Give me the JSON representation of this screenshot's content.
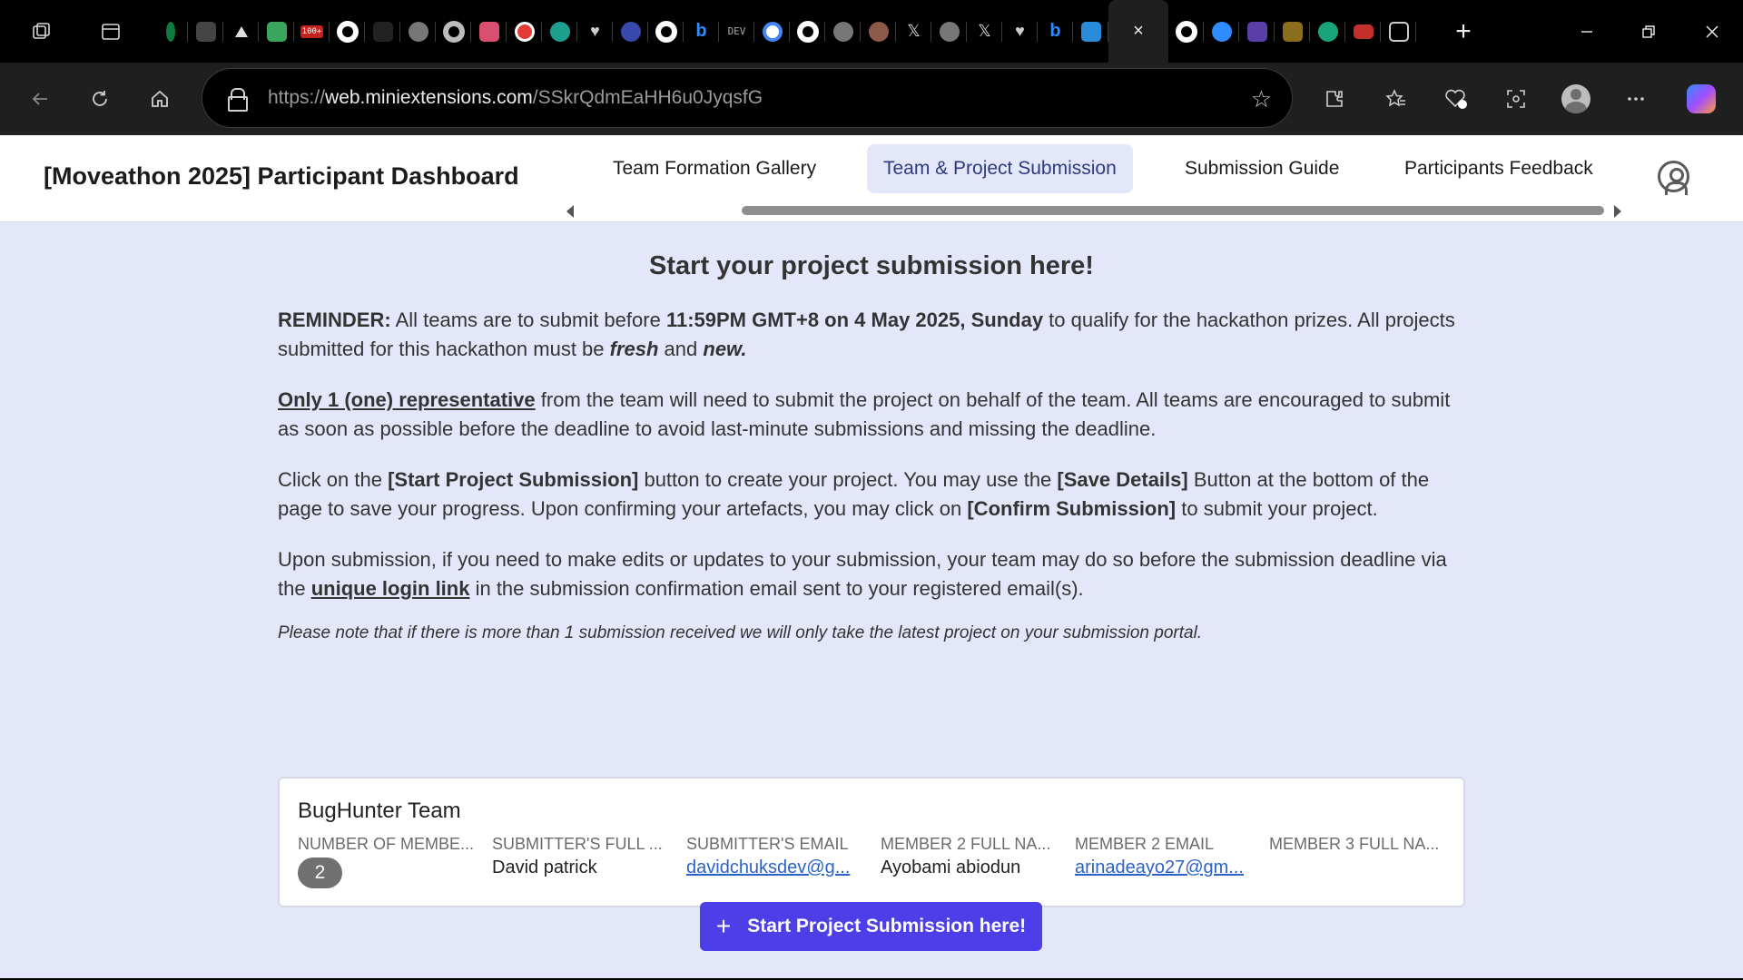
{
  "browser": {
    "url_prefix": "https://",
    "url_domain": "web.miniextensions.com",
    "url_path": "/SSkrQdmEaHH6u0JyqsfG",
    "active_tab_close": "×",
    "new_tab": "+",
    "fav_dev_label": "DEV",
    "fav_100_label": "100+",
    "fav_x_label": "𝕏",
    "colors": {
      "frame": "#000000",
      "toolbar": "#1f1f1f"
    }
  },
  "header": {
    "title": "[Moveathon 2025] Participant Dashboard",
    "tabs": [
      {
        "label": "Team Formation Gallery",
        "active": false
      },
      {
        "label": "Team & Project Submission",
        "active": true
      },
      {
        "label": "Submission Guide",
        "active": false
      },
      {
        "label": "Participants Feedback",
        "active": false
      }
    ]
  },
  "main": {
    "heading": "Start your project submission here!",
    "reminder": {
      "label": "REMINDER:",
      "text1": " All teams are to submit before ",
      "deadline": "11:59PM GMT+8 on 4 May 2025, Sunday",
      "text2": " to qualify for the hackathon prizes. All projects submitted for this hackathon must be ",
      "fresh": "fresh",
      "and": " and ",
      "new": "new."
    },
    "representative": {
      "emph": "Only 1 (one) representative",
      "text": " from the team will need to submit the project on behalf of the team. All teams are encouraged to submit as soon as possible before the deadline to avoid last-minute submissions and missing the deadline."
    },
    "instructions": {
      "t1": "Click on the ",
      "b1": "[Start Project Submission]",
      "t2": " button to create your project. You may use the ",
      "b2": "[Save Details]",
      "t3": " Button at the bottom of the page to save your progress. Upon confirming your artefacts, you may click on ",
      "b3": "[Confirm Submission]",
      "t4": " to submit your project."
    },
    "edits": {
      "t1": "Upon submission, if you need to make edits or updates to your submission, your team may do so before the submission deadline via the ",
      "link": "unique login link",
      "t2": " in the submission confirmation email sent to your registered email(s)."
    },
    "note": "Please note that if there is more than 1 submission received we will only take the latest project on your submission portal.",
    "team_card": {
      "name": "BugHunter Team",
      "columns": [
        {
          "label": "NUMBER OF MEMBE...",
          "value": "2"
        },
        {
          "label": "SUBMITTER'S FULL ...",
          "value": "David patrick"
        },
        {
          "label": "SUBMITTER'S EMAIL",
          "value": "davidchuksdev@g..."
        },
        {
          "label": "MEMBER 2 FULL NA...",
          "value": "Ayobami abiodun"
        },
        {
          "label": "MEMBER 2 EMAIL",
          "value": "arinadeayo27@gm..."
        },
        {
          "label": "MEMBER 3 FULL NA...",
          "value": ""
        }
      ]
    },
    "start_button": {
      "icon": "+",
      "label": "Start Project Submission here!"
    },
    "colors": {
      "page_bg": "#e4e7fa",
      "primary": "#4d3ee8",
      "link": "#2d62c8"
    }
  }
}
